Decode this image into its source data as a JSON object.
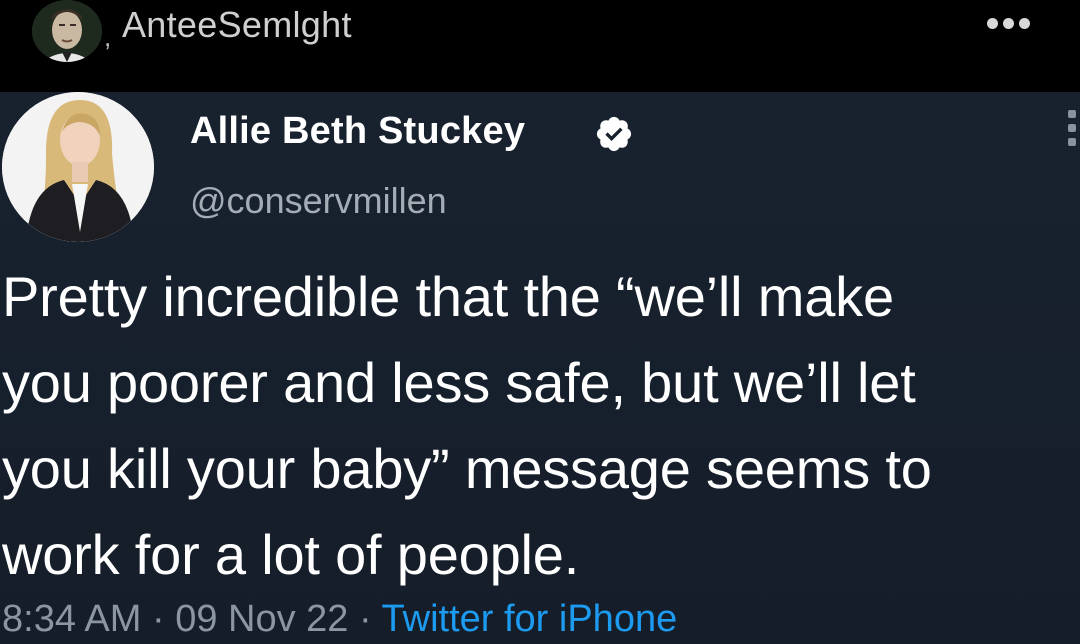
{
  "header": {
    "username": "AnteeSemlght",
    "more_icon": "more-horizontal-icon"
  },
  "tweet": {
    "display_name": "Allie Beth Stuckey",
    "handle": "@conservmillen",
    "verified_icon": "verified-badge-icon",
    "text_lines": [
      "Pretty incredible that the “we’ll make",
      "you poorer and less safe, but we’ll let",
      "you kill your baby” message seems to",
      "work for a lot of people."
    ],
    "time": "8:34 AM",
    "separator": "·",
    "date": "09 Nov 22",
    "source": "Twitter for iPhone"
  },
  "colors": {
    "tweet_background": "#15202b",
    "link_blue": "#1d9bf0",
    "verified_badge": "#ffffff"
  }
}
